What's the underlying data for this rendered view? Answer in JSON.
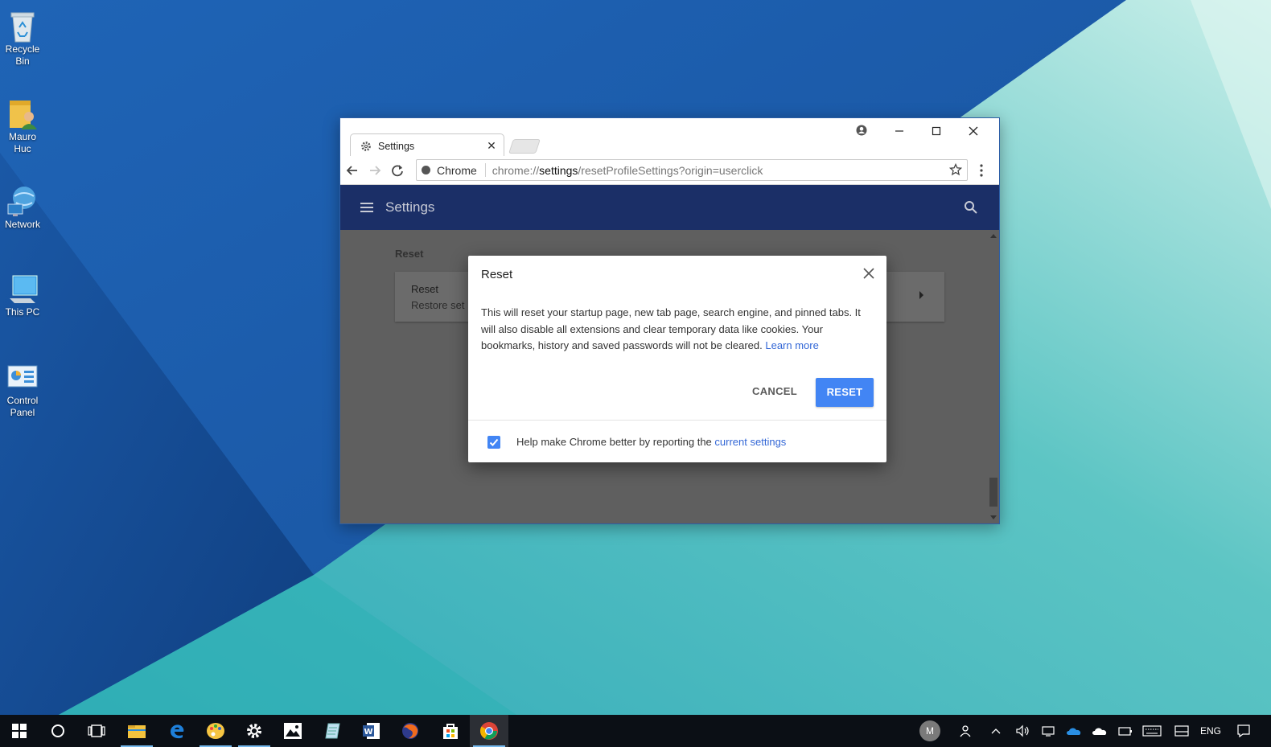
{
  "desktop": {
    "icons": [
      {
        "label": "Recycle\nBin",
        "icon": "recycle-bin-icon"
      },
      {
        "label": "Mauro\nHuc",
        "icon": "user-folder-icon"
      },
      {
        "label": "Network",
        "icon": "network-icon"
      },
      {
        "label": "This PC",
        "icon": "this-pc-icon"
      },
      {
        "label": "Control\nPanel",
        "icon": "control-panel-icon"
      }
    ],
    "labels": {
      "recycle_1": "Recycle",
      "recycle_2": "Bin",
      "mauro_1": "Mauro",
      "mauro_2": "Huc",
      "network": "Network",
      "thispc": "This PC",
      "cp_1": "Control",
      "cp_2": "Panel"
    }
  },
  "browser": {
    "tab_title": "Settings",
    "tab_close": "✕",
    "site_chip": "Chrome",
    "url_scheme": "chrome://",
    "url_host": "settings",
    "url_path": "/resetProfileSettings?origin=userclick"
  },
  "settings": {
    "header_title": "Settings",
    "section_label": "Reset",
    "card_title": "Reset",
    "card_subtitle": "Restore set"
  },
  "dialog": {
    "title": "Reset",
    "body": "This will reset your startup page, new tab page, search engine, and pinned tabs. It will also disable all extensions and clear temporary data like cookies. Your bookmarks, history and saved passwords will not be cleared.",
    "learn_more": "Learn more",
    "cancel_label": "CANCEL",
    "reset_label": "RESET",
    "footer_text": "Help make Chrome better by reporting the",
    "footer_link": "current settings",
    "checkbox_checked": true
  },
  "taskbar": {
    "apps": [
      "start-icon",
      "cortana-icon",
      "task-view-icon",
      "file-explorer-icon",
      "edge-icon",
      "paint-icon",
      "settings-icon",
      "photos-icon",
      "notepad-icon",
      "word-icon",
      "firefox-icon",
      "store-icon",
      "chrome-icon"
    ],
    "avatar_initial": "M",
    "language": "ENG"
  },
  "colors": {
    "accent": "#4285f4",
    "settings_header": "#1b2f67",
    "taskbar": "#0b0f15"
  }
}
